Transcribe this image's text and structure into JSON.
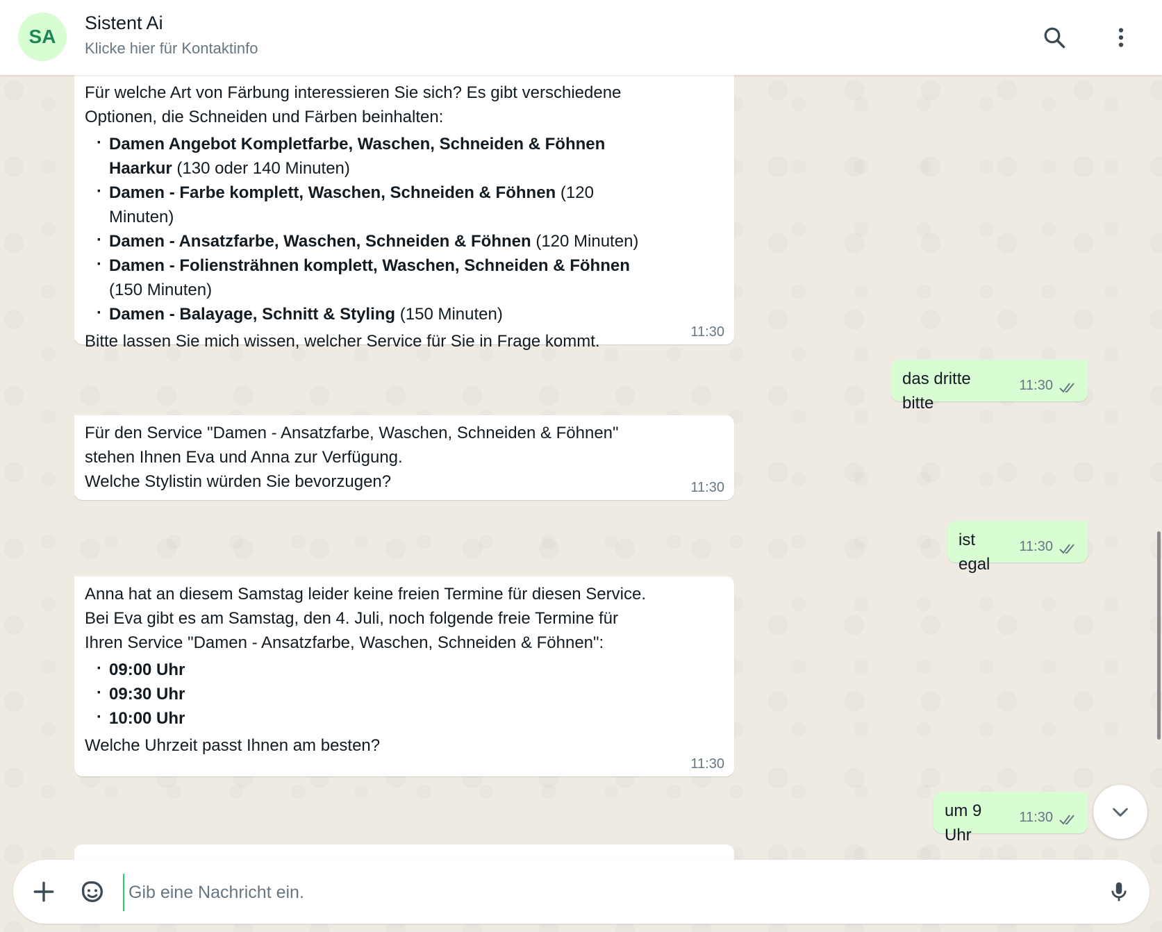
{
  "header": {
    "avatar_initials": "SA",
    "contact_name": "Sistent Ai",
    "contact_subtitle": "Klicke hier für Kontaktinfo"
  },
  "messages": [
    {
      "direction": "incoming",
      "intro": "Für welche Art von Färbung interessieren Sie sich? Es gibt verschiedene Optionen, die Schneiden und Färben beinhalten:",
      "items": [
        {
          "bold": "Damen Angebot Kompletfarbe, Waschen, Schneiden & Föhnen Haarkur",
          "rest": " (130 oder 140 Minuten)"
        },
        {
          "bold": "Damen - Farbe komplett, Waschen, Schneiden & Föhnen",
          "rest": " (120 Minuten)"
        },
        {
          "bold": "Damen - Ansatzfarbe, Waschen, Schneiden & Föhnen",
          "rest": " (120 Minuten)"
        },
        {
          "bold": "Damen - Foliensträhnen komplett, Waschen, Schneiden & Föhnen",
          "rest": " (150 Minuten)"
        },
        {
          "bold": "Damen - Balayage, Schnitt & Styling",
          "rest": " (150 Minuten)"
        }
      ],
      "outro": "Bitte lassen Sie mich wissen, welcher Service für Sie in Frage kommt.",
      "time": "11:30"
    },
    {
      "direction": "outgoing",
      "text": "das dritte bitte",
      "time": "11:30",
      "status": "read"
    },
    {
      "direction": "incoming",
      "line1": "Für den Service \"Damen - Ansatzfarbe, Waschen, Schneiden & Föhnen\" stehen Ihnen Eva und Anna zur Verfügung.",
      "line2": "Welche Stylistin würden Sie bevorzugen?",
      "time": "11:30"
    },
    {
      "direction": "outgoing",
      "text": "ist egal",
      "time": "11:30",
      "status": "read"
    },
    {
      "direction": "incoming",
      "line1": "Anna hat an diesem Samstag leider keine freien Termine für diesen Service.",
      "line2": "Bei Eva gibt es am Samstag, den 4. Juli, noch folgende freie Termine für Ihren Service \"Damen - Ansatzfarbe, Waschen, Schneiden & Föhnen\":",
      "slots": [
        "09:00 Uhr",
        "09:30 Uhr",
        "10:00 Uhr"
      ],
      "outro": "Welche Uhrzeit passt Ihnen am besten?",
      "time": "11:30"
    },
    {
      "direction": "outgoing",
      "text": "um 9 Uhr",
      "time": "11:30",
      "status": "read"
    }
  ],
  "composer": {
    "placeholder": "Gib eine Nachricht ein."
  },
  "icons": {
    "search": "search-icon",
    "menu": "more-vertical-icon",
    "scroll_down": "chevron-down-icon",
    "plus": "plus-icon",
    "sticker": "sticker-icon",
    "mic": "microphone-icon",
    "read": "double-check-icon"
  },
  "colors": {
    "outgoing_bubble": "#d9fdd3",
    "incoming_bubble": "#ffffff",
    "chat_background": "#efeae2",
    "accent": "#25d366"
  }
}
